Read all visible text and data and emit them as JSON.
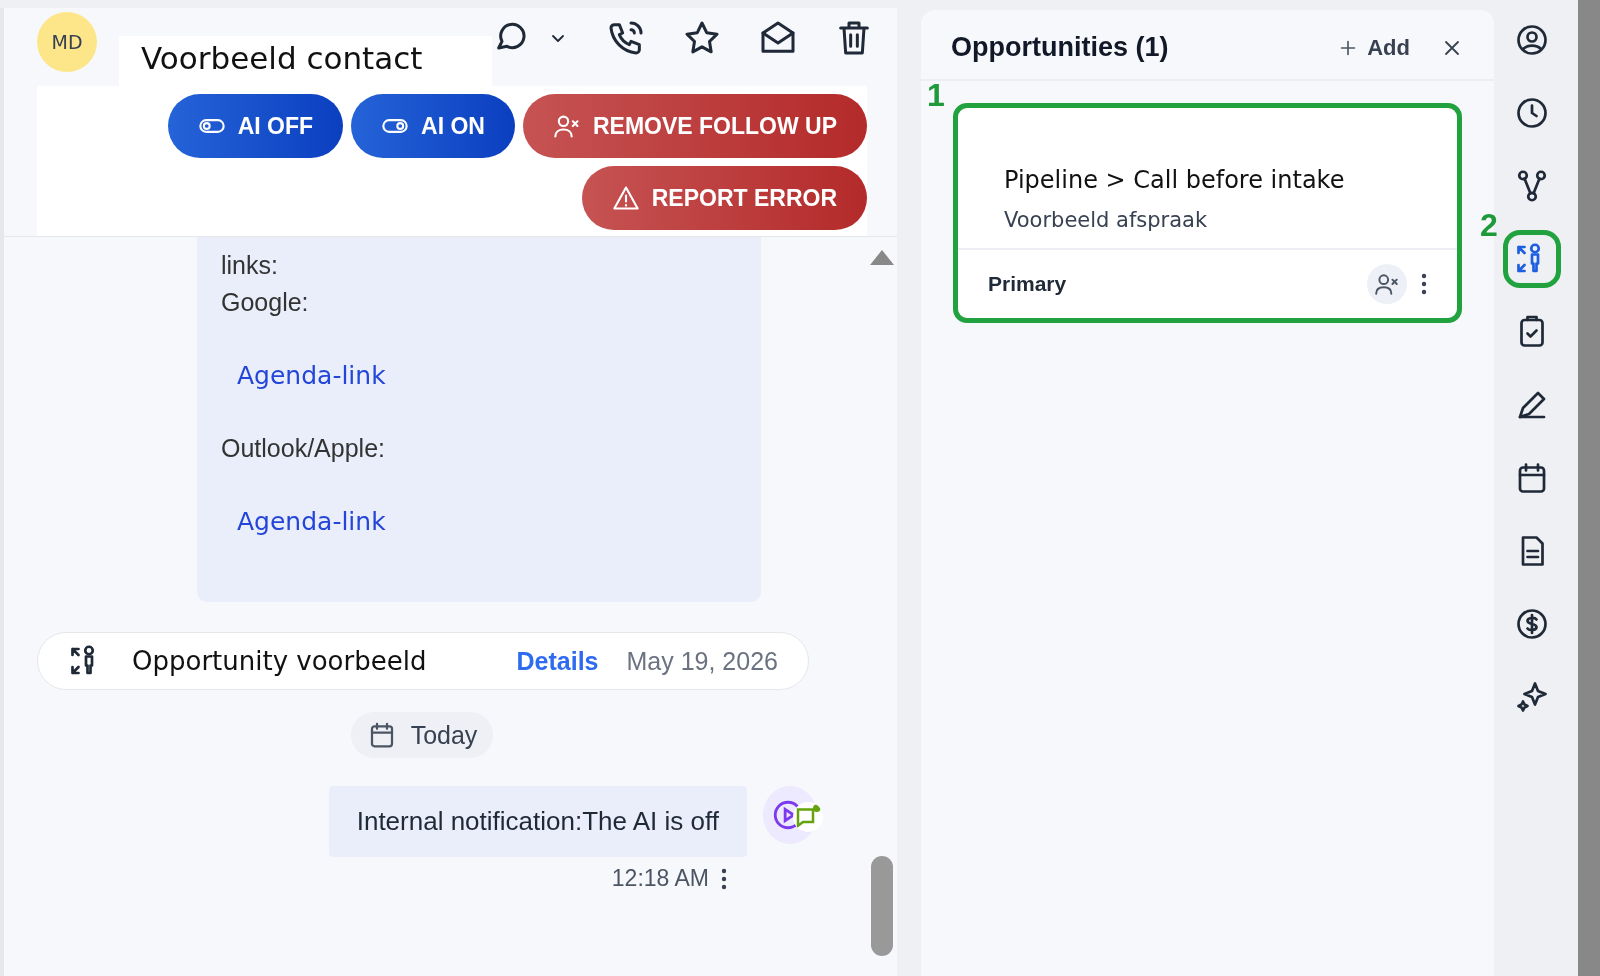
{
  "contact": {
    "initials": "MD",
    "name": "Voorbeeld contact"
  },
  "actions": [
    {
      "label": "AI OFF",
      "kind": "off"
    },
    {
      "label": "AI ON",
      "kind": "on"
    },
    {
      "label": "REMOVE FOLLOW UP",
      "kind": "unfollow"
    },
    {
      "label": "REPORT ERROR",
      "kind": "error"
    }
  ],
  "message": {
    "lines": [
      {
        "kind": "text",
        "text": "links:"
      },
      {
        "kind": "text",
        "text": "Google:"
      },
      {
        "kind": "link",
        "text": "Agenda-link"
      },
      {
        "kind": "text",
        "text": "Outlook/Apple:"
      },
      {
        "kind": "link",
        "text": "Agenda-link"
      }
    ]
  },
  "opportunity_event": {
    "name": "Opportunity voorbeeld",
    "link": "Details",
    "date": "May 19, 2026"
  },
  "date_divider": "Today",
  "notification": {
    "text": "Internal notification:The AI is off",
    "time": "12:18 AM"
  },
  "opportunities": {
    "title": "Opportunities (1)",
    "add": "Add",
    "cards": [
      {
        "callout": "1",
        "path": "Pipeline > Call before intake",
        "name": "Voorbeeld afspraak",
        "tag": "Primary"
      }
    ]
  },
  "rail": [
    {
      "kind": "contact",
      "selected": false
    },
    {
      "kind": "history",
      "selected": false
    },
    {
      "kind": "workflow",
      "selected": false
    },
    {
      "kind": "opportunity",
      "selected": true,
      "callout": "2"
    },
    {
      "kind": "tasks",
      "selected": false
    },
    {
      "kind": "notes",
      "selected": false
    },
    {
      "kind": "calendar",
      "selected": false
    },
    {
      "kind": "documents",
      "selected": false
    },
    {
      "kind": "payments",
      "selected": false
    },
    {
      "kind": "ai",
      "selected": false
    }
  ]
}
